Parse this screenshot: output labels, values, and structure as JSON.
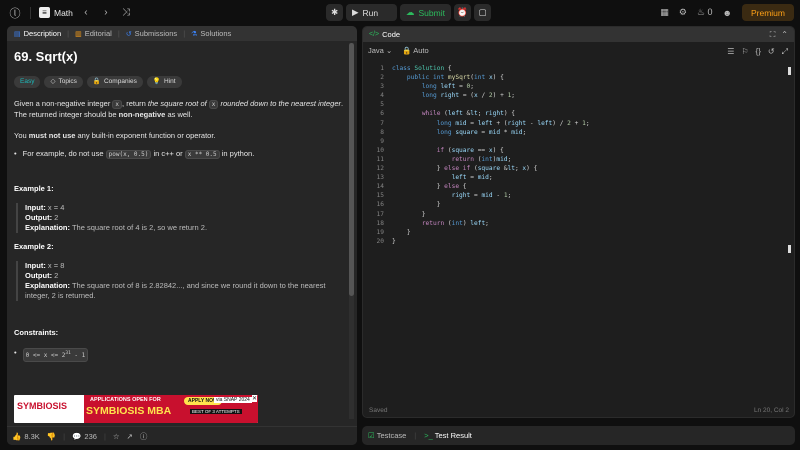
{
  "topbar": {
    "logo_icon": "leetcode-logo-icon",
    "problem_list_label": "Math",
    "run_label": "Run",
    "submit_label": "Submit",
    "premium_label": "Premium",
    "streak_count": "0"
  },
  "left_tabs": [
    "Description",
    "Editorial",
    "Submissions",
    "Solutions"
  ],
  "problem": {
    "title": "69. Sqrt(x)",
    "difficulty": "Easy",
    "chips": [
      "Topics",
      "Companies",
      "Hint"
    ],
    "desc_1": "Given a non-negative integer",
    "desc_var": "x",
    "desc_2": ", return",
    "desc_italic": "the square root of",
    "desc_var2": "x",
    "desc_italic2": "rounded down to the nearest integer",
    "desc_3": ".",
    "desc_line2a": "The returned integer should be",
    "desc_line2b": "non-negative",
    "desc_line2c": "as well.",
    "rule_a": "You",
    "rule_b": "must not use",
    "rule_c": "any built-in exponent function or operator.",
    "bullet_a": "For example, do not use",
    "bullet_code1": "pow(x, 0.5)",
    "bullet_b": "in c++ or",
    "bullet_code2": "x ** 0.5",
    "bullet_c": "in python.",
    "examples": [
      {
        "title": "Example 1:",
        "input_label": "Input:",
        "input": "x = 4",
        "output_label": "Output:",
        "output": "2",
        "explanation_label": "Explanation:",
        "explanation": "The square root of 4 is 2, so we return 2."
      },
      {
        "title": "Example 2:",
        "input_label": "Input:",
        "input": "x = 8",
        "output_label": "Output:",
        "output": "2",
        "explanation_label": "Explanation:",
        "explanation": "The square root of 8 is 2.82842..., and since we round it down to the nearest integer, 2 is returned."
      }
    ],
    "constraints_title": "Constraints:",
    "constraint_base": "0 <= x <= 2",
    "constraint_exp": "31",
    "constraint_tail": " - 1"
  },
  "ad": {
    "brand": "SYMBIOSIS",
    "line1": "APPLICATIONS OPEN FOR",
    "line2": "SYMBIOSIS MBA",
    "apply": "APPLY NOW",
    "via": "via SNAP 2024",
    "best": "BEST OF 3 ATTEMPTS"
  },
  "left_footer": {
    "likes": "8.3K",
    "comments": "236"
  },
  "editor": {
    "title": "Code",
    "language": "Java",
    "autosave": "Auto",
    "status_saved": "Saved",
    "cursor_pos": "Ln 20, Col 2"
  },
  "code_lines": [
    "class Solution {",
    "    public int mySqrt(int x) {",
    "        long left = 0;",
    "        long right = (x / 2) + 1;",
    "",
    "        while (left < right) {",
    "            long mid = left + (right - left) / 2 + 1;",
    "            long square = mid * mid;",
    "",
    "            if (square == x) {",
    "                return (int)mid;",
    "            } else if (square < x) {",
    "                left = mid;",
    "            } else {",
    "                right = mid - 1;",
    "            }",
    "        }",
    "        return (int) left;",
    "    }",
    "}"
  ],
  "testbar": {
    "testcase": "Testcase",
    "result": "Test Result"
  }
}
